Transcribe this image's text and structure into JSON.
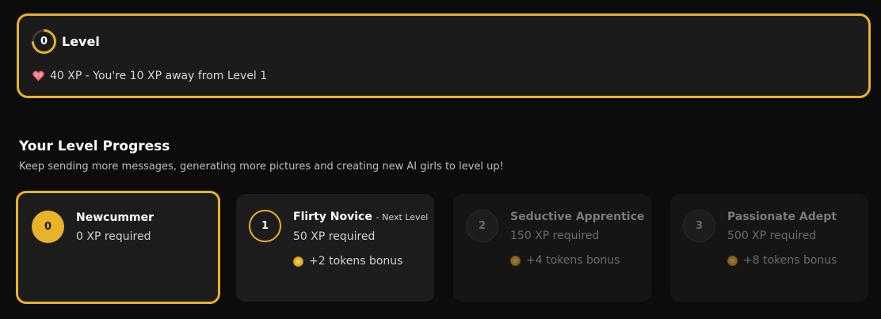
{
  "level_card": {
    "level_number": "0",
    "title": "Level",
    "xp_status": "40 XP - You're 10 XP away from Level 1"
  },
  "progress": {
    "title": "Your Level Progress",
    "subtitle": "Keep sending more messages, generating more pictures and creating new AI girls to level up!",
    "tiers": [
      {
        "number": "0",
        "name": "Newcummer",
        "tag": "",
        "requirement": "0 XP required",
        "bonus": "",
        "state": "current"
      },
      {
        "number": "1",
        "name": "Flirty Novice",
        "tag": "- Next Level",
        "requirement": "50 XP required",
        "bonus": "+2 tokens bonus",
        "state": "next"
      },
      {
        "number": "2",
        "name": "Seductive Apprentice",
        "tag": "",
        "requirement": "150 XP required",
        "bonus": "+4 tokens bonus",
        "state": "locked"
      },
      {
        "number": "3",
        "name": "Passionate Adept",
        "tag": "",
        "requirement": "500 XP required",
        "bonus": "+8 tokens bonus",
        "state": "locked"
      }
    ]
  },
  "colors": {
    "accent": "#e8b22a",
    "background": "#0c0c0c",
    "card": "#1c1c1c"
  },
  "icons": {
    "xp": "heart-icon",
    "bonus": "coin-icon"
  }
}
